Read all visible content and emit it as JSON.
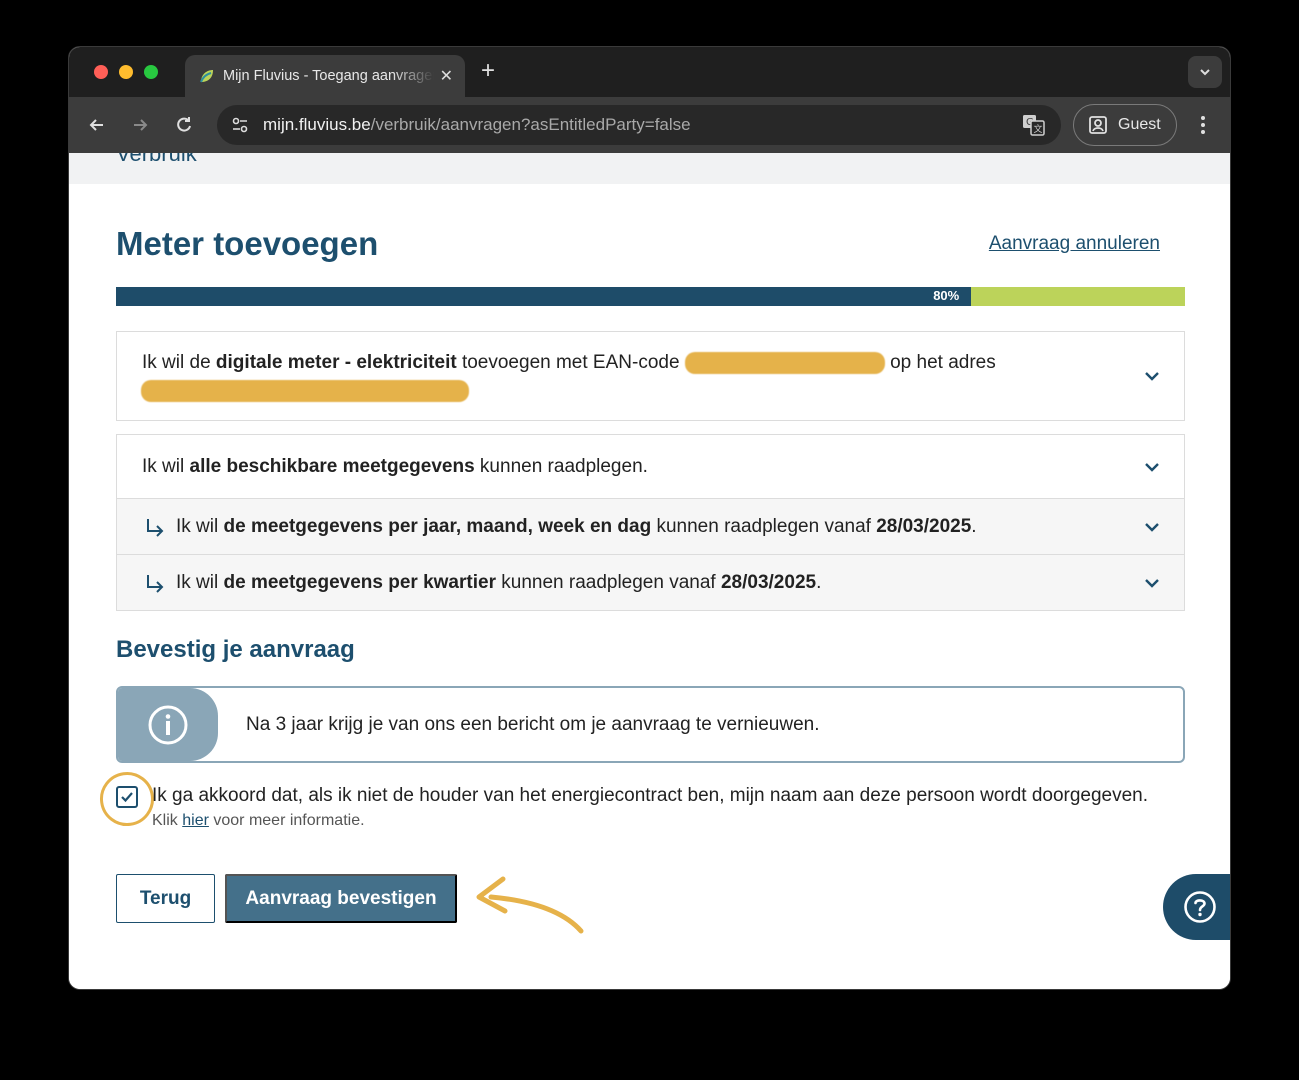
{
  "browser": {
    "tab_title": "Mijn Fluvius - Toegang aanvragen",
    "url_host": "mijn.fluvius.be",
    "url_path": "/verbruik/aanvragen?asEntitledParty=false",
    "profile_label": "Guest"
  },
  "page": {
    "breadcrumb": "Verbruik",
    "title": "Meter toevoegen",
    "cancel_link": "Aanvraag annuleren",
    "progress": {
      "value": 0.8,
      "label": "80%"
    },
    "request_items": [
      {
        "pre": "Ik wil de ",
        "bold": "digitale meter - elektriciteit",
        "post": " toevoegen met EAN-code ",
        "post2": " op het adres"
      },
      {
        "pre": "Ik wil ",
        "bold": "alle beschikbare meetgegevens",
        "post": " kunnen raadplegen."
      },
      {
        "pre": "Ik wil ",
        "bold": "de meetgegevens per jaar, maand, week en dag",
        "post": " kunnen raadplegen vanaf ",
        "date": "28/03/2025",
        "end": "."
      },
      {
        "pre": "Ik wil ",
        "bold": "de meetgegevens per kwartier",
        "post": " kunnen raadplegen vanaf ",
        "date": "28/03/2025",
        "end": "."
      }
    ],
    "confirm_heading": "Bevestig je aanvraag",
    "info_message": "Na 3 jaar krijg je van ons een bericht om je aanvraag te vernieuwen.",
    "consent": {
      "checked": true,
      "label": "Ik ga akkoord dat, als ik niet de houder van het energiecontract ben, mijn naam aan deze persoon wordt doorgegeven.",
      "sub_pre": "Klik ",
      "sub_link": "hier",
      "sub_post": " voor meer informatie."
    },
    "buttons": {
      "back": "Terug",
      "confirm": "Aanvraag bevestigen"
    }
  },
  "colors": {
    "brand_dark": "#1d4f6e",
    "progress_fill": "#1e4c69",
    "progress_rest": "#bcd35a",
    "annotation": "#e6b24a"
  }
}
